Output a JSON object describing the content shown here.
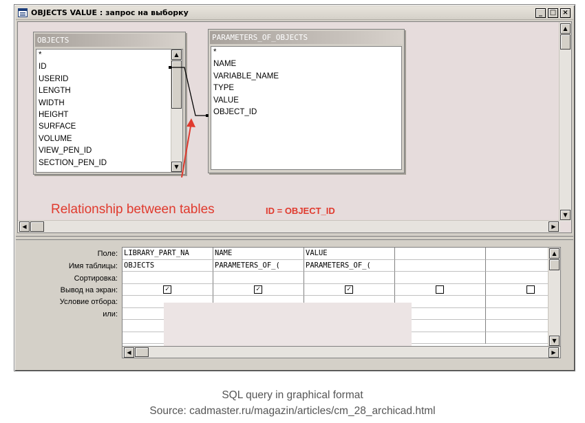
{
  "window": {
    "title": "OBJECTS VALUE : запрос на выборку",
    "minimize": "_",
    "maximize": "□",
    "close": "×"
  },
  "tables": {
    "objects": {
      "name": "OBJECTS",
      "fields": [
        "*",
        "ID",
        "USERID",
        "LENGTH",
        "WIDTH",
        "HEIGHT",
        "SURFACE",
        "VOLUME",
        "VIEW_PEN_ID",
        "SECTION_PEN_ID"
      ]
    },
    "parameters": {
      "name": "PARAMETERS_OF_OBJECTS",
      "fields": [
        "*",
        "NAME",
        "VARIABLE_NAME",
        "TYPE",
        "VALUE",
        "OBJECT_ID"
      ]
    }
  },
  "annotation": {
    "text": "Relationship between tables",
    "equation": "ID = OBJECT_ID"
  },
  "grid": {
    "row_labels": [
      "Поле:",
      "Имя таблицы:",
      "Сортировка:",
      "Вывод на экран:",
      "Условие отбора:",
      "или:"
    ],
    "columns": [
      {
        "field": "LIBRARY_PART_NA",
        "table": "OBJECTS",
        "show": true
      },
      {
        "field": "NAME",
        "table": "PARAMETERS_OF_(",
        "show": true
      },
      {
        "field": "VALUE",
        "table": "PARAMETERS_OF_(",
        "show": true
      },
      {
        "field": "",
        "table": "",
        "show": false
      },
      {
        "field": "",
        "table": "",
        "show": false
      }
    ],
    "checked_mark": "☑",
    "unchecked_mark": "☐"
  },
  "caption": {
    "line1": "SQL query in graphical format",
    "line2": "Source: cadmaster.ru/magazin/articles/cm_28_archicad.html"
  },
  "colors": {
    "annotation": "#e03a2e",
    "pane_background": "#e6dcdc"
  }
}
